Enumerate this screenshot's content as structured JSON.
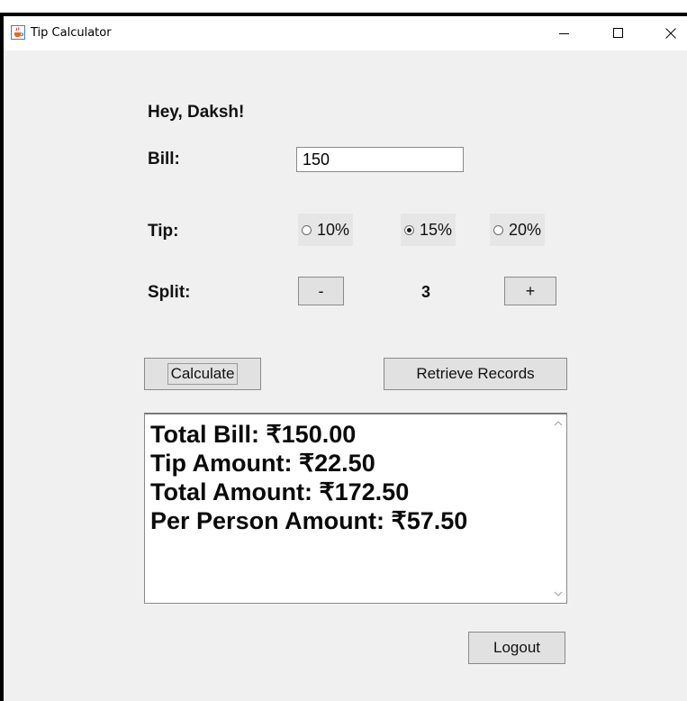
{
  "window": {
    "title": "Tip Calculator"
  },
  "greeting": "Hey, Daksh!",
  "bill": {
    "label": "Bill:",
    "value": "150"
  },
  "tip": {
    "label": "Tip:",
    "options": [
      "10%",
      "15%",
      "20%"
    ],
    "selected": "15%"
  },
  "split": {
    "label": "Split:",
    "decrement_label": "-",
    "value": "3",
    "increment_label": "+"
  },
  "actions": {
    "calculate_label": "Calculate",
    "retrieve_label": "Retrieve Records",
    "logout_label": "Logout"
  },
  "results": {
    "total_bill": "Total Bill: ₹150.00",
    "tip_amount": "Tip Amount: ₹22.50",
    "total_amount": "Total Amount: ₹172.50",
    "per_person": "Per Person Amount: ₹57.50"
  },
  "icons": {
    "app": "java-cup-icon",
    "minimize": "minimize-icon",
    "maximize": "maximize-icon",
    "close": "close-icon"
  }
}
